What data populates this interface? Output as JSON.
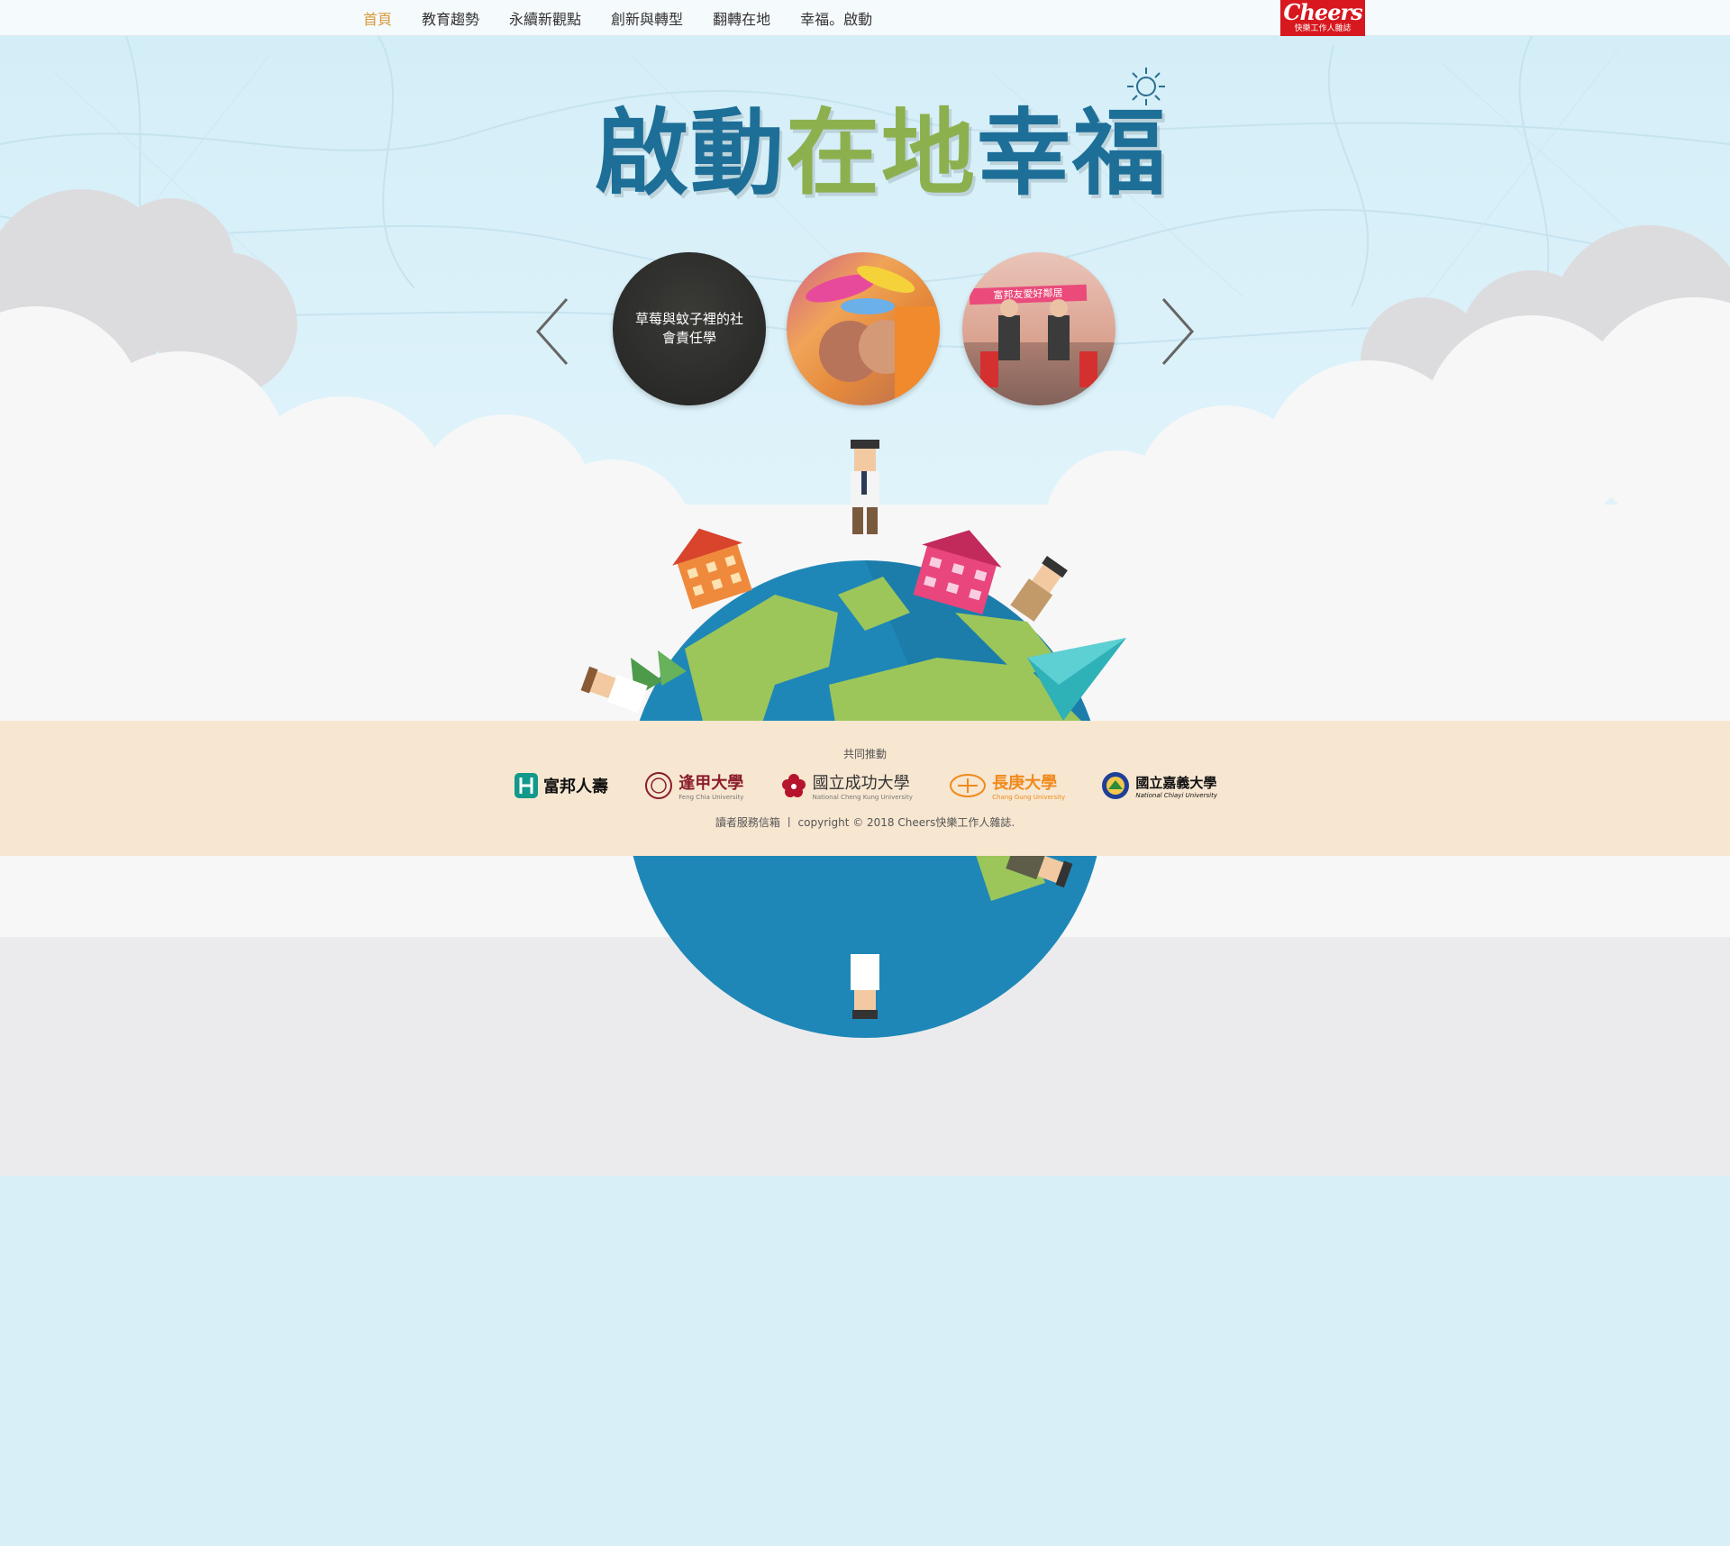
{
  "nav": {
    "items": [
      {
        "label": "首頁",
        "active": true
      },
      {
        "label": "教育趨勢",
        "active": false
      },
      {
        "label": "永續新觀點",
        "active": false
      },
      {
        "label": "創新與轉型",
        "active": false
      },
      {
        "label": "翻轉在地",
        "active": false
      },
      {
        "label": "幸福。啟動",
        "active": false
      }
    ],
    "logo": {
      "brand": "Cheers",
      "tagline": "快樂工作人雜誌"
    }
  },
  "hero": {
    "title": {
      "part1": "啟動",
      "part2": "在地",
      "part3": "幸福"
    },
    "carousel": [
      {
        "caption": "草莓與蚊子裡的社會責任學"
      },
      {
        "caption": ""
      },
      {
        "caption": "",
        "banner": "富邦友愛好鄰居"
      }
    ]
  },
  "footer": {
    "together_label": "共同推動",
    "partners": [
      {
        "name": "富邦人壽",
        "sub": ""
      },
      {
        "name": "逢甲大學",
        "sub": "Feng Chia University"
      },
      {
        "name": "國立成功大學",
        "sub": "National Cheng Kung University"
      },
      {
        "name": "長庚大學",
        "sub": "Chang Gung University"
      },
      {
        "name": "國立嘉義大學",
        "sub": "National Chiayi University"
      }
    ],
    "mailbox_label": "讀者服務信箱",
    "separator": "丨",
    "copyright": "copyright © 2018 Cheers快樂工作人雜誌."
  },
  "colors": {
    "accent_nav_active": "#d79a3a",
    "title_blue": "#1d6f98",
    "title_green": "#8db04f",
    "strip_bg": "#f7e6d0",
    "sky": "#d9eff7",
    "brand_red": "#d7181f",
    "globe_ocean": "#1f87b7",
    "globe_land": "#9cc65a"
  }
}
